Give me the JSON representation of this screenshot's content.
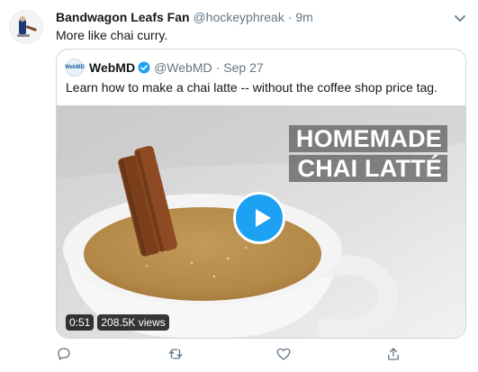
{
  "tweet": {
    "display_name": "Bandwagon Leafs Fan",
    "handle": "@hockeyphreak",
    "separator": "·",
    "time": "9m",
    "text": "More like chai curry."
  },
  "quoted": {
    "avatar_label": "WebMD",
    "display_name": "WebMD",
    "handle": "@WebMD",
    "separator": "·",
    "time": "Sep 27",
    "text": "Learn how to make a chai latte -- without the coffee shop price tag.",
    "media": {
      "title_line1": "HOMEMADE",
      "title_line2": "CHAI LATTÉ",
      "duration": "0:51",
      "views": "208.5K views"
    }
  },
  "actions": [
    "reply-icon",
    "retweet-icon",
    "like-icon",
    "share-icon"
  ],
  "colors": {
    "link_blue": "#1da1f2",
    "secondary_text": "#657786",
    "border": "#ccd6dd"
  }
}
